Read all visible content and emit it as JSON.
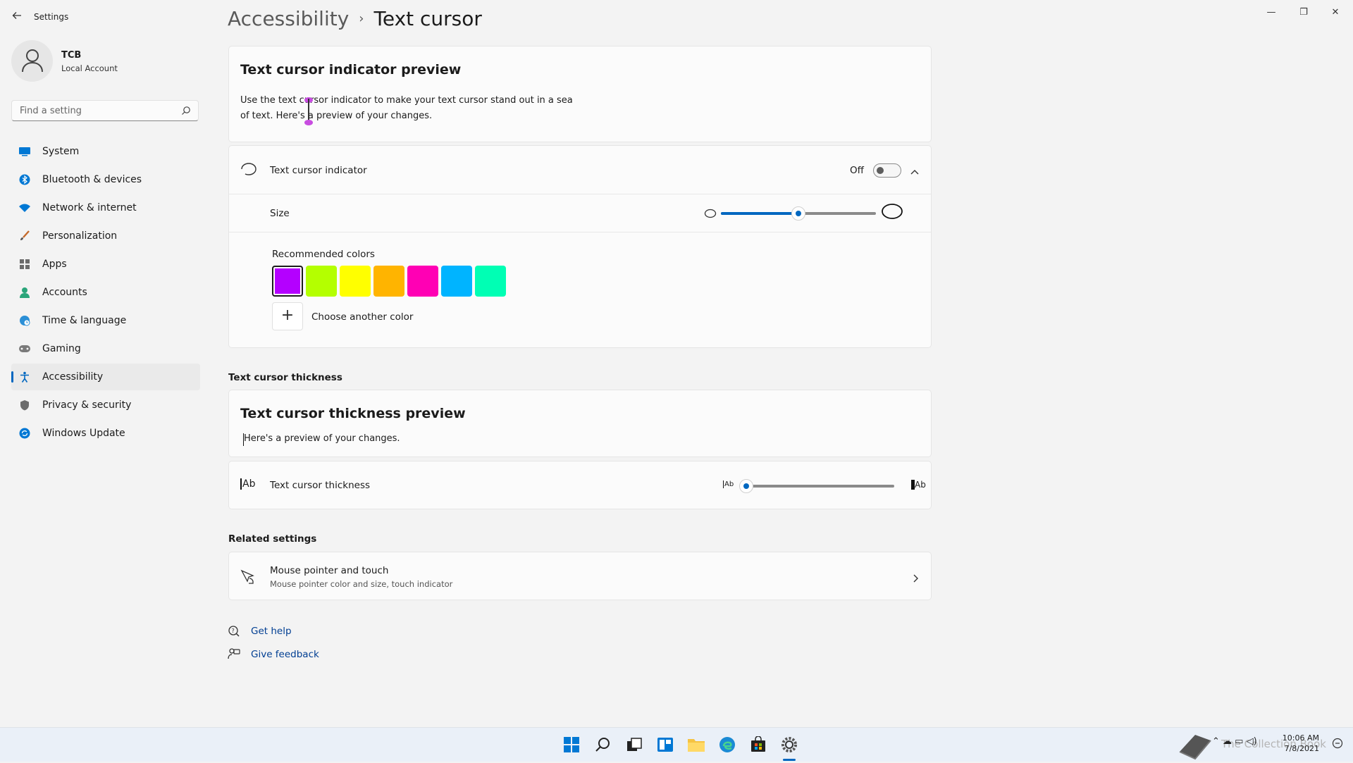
{
  "window": {
    "app_title": "Settings",
    "controls": {
      "minimize": "—",
      "restore": "❐",
      "close": "✕"
    }
  },
  "user": {
    "name": "TCB",
    "account_type": "Local Account"
  },
  "search": {
    "placeholder": "Find a setting"
  },
  "sidebar": {
    "items": [
      {
        "label": "System",
        "icon": "monitor-icon",
        "active": false
      },
      {
        "label": "Bluetooth & devices",
        "icon": "bluetooth-icon",
        "active": false
      },
      {
        "label": "Network & internet",
        "icon": "wifi-icon",
        "active": false
      },
      {
        "label": "Personalization",
        "icon": "brush-icon",
        "active": false
      },
      {
        "label": "Apps",
        "icon": "apps-icon",
        "active": false
      },
      {
        "label": "Accounts",
        "icon": "person-icon",
        "active": false
      },
      {
        "label": "Time & language",
        "icon": "globe-clock-icon",
        "active": false
      },
      {
        "label": "Gaming",
        "icon": "gamepad-icon",
        "active": false
      },
      {
        "label": "Accessibility",
        "icon": "accessibility-icon",
        "active": true
      },
      {
        "label": "Privacy & security",
        "icon": "shield-icon",
        "active": false
      },
      {
        "label": "Windows Update",
        "icon": "update-icon",
        "active": false
      }
    ]
  },
  "breadcrumb": {
    "parent": "Accessibility",
    "separator": "›",
    "current": "Text cursor"
  },
  "indicator_preview": {
    "title": "Text cursor indicator preview",
    "line1": "Use the text cursor indicator to make your text cursor stand out in a sea",
    "line2": "of text. Here's a preview of your changes."
  },
  "indicator": {
    "label": "Text cursor indicator",
    "toggle_state": "Off",
    "size_label": "Size",
    "size_level": 0.5,
    "colors_label": "Recommended colors",
    "colors": [
      "#b400ff",
      "#b4ff00",
      "#ffff00",
      "#ffb400",
      "#ff00b4",
      "#00b4ff",
      "#00ffb4"
    ],
    "selected_color_index": 0,
    "choose_color_label": "Choose another color",
    "add_symbol": "+"
  },
  "thickness_section": {
    "heading": "Text cursor thickness",
    "preview_title": "Text cursor thickness preview",
    "preview_text": "Here's a preview of your changes.",
    "row_label": "Text cursor thickness",
    "slider_icon_text": "Ab",
    "thickness_level": 0.0
  },
  "related": {
    "heading": "Related settings",
    "title": "Mouse pointer and touch",
    "subtitle": "Mouse pointer color and size, touch indicator"
  },
  "help": {
    "get_help": "Get help",
    "give_feedback": "Give feedback"
  },
  "taskbar": {
    "icons": [
      "start-icon",
      "search-icon",
      "task-view-icon",
      "widgets-icon",
      "file-explorer-icon",
      "edge-icon",
      "store-icon",
      "settings-icon"
    ],
    "time": "10:06 AM",
    "date": "7/8/2021",
    "watermark": "The Collection Book"
  },
  "colors": {
    "accent": "#0067c0",
    "background": "#f3f3f3",
    "card": "#fbfbfb"
  }
}
